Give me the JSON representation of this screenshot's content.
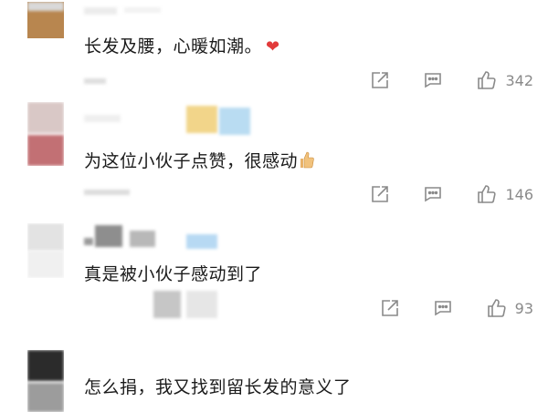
{
  "comments": [
    {
      "text": "长发及腰，心暖如潮。",
      "likes": "342",
      "emoji": "heart"
    },
    {
      "text": "为这位小伙子点赞，很感动",
      "likes": "146",
      "emoji": "thumbs-up"
    },
    {
      "text": "真是被小伙子感动到了",
      "likes": "93"
    },
    {
      "text": "怎么捐，我又找到留长发的意义了"
    }
  ],
  "icons": {
    "share": "share-icon",
    "reply": "comment-icon",
    "like": "thumbs-up-icon"
  }
}
